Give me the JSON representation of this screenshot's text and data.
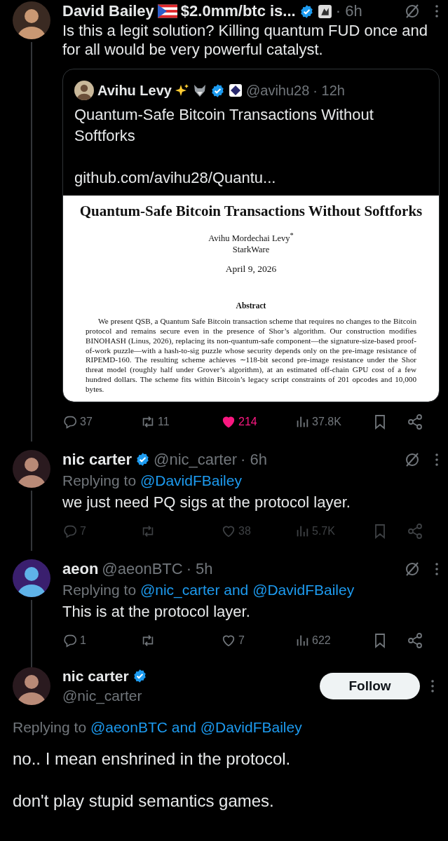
{
  "thread": [
    {
      "name": "David Bailey",
      "name_suffix": "$2.0mm/btc is...",
      "verified": true,
      "affiliate": true,
      "time": "· 6h",
      "text": "Is this a legit solution? Killing quantum FUD once and for all would be very powerful catalyst.",
      "quote": {
        "name": "Avihu Levy",
        "verified": true,
        "handle": "@avihu28",
        "time": "· 12h",
        "text": "Quantum-Safe Bitcoin Transactions Without Softforks",
        "link": "github.com/avihu28/Quantu...",
        "paper": {
          "title": "Quantum-Safe Bitcoin Transactions Without Softforks",
          "author": "Avihu Mordechai Levy$^{*}$",
          "affiliation": "StarkWare",
          "date": "April 9, 2026",
          "abstract_heading": "Abstract",
          "abstract": "We present QSB, a Quantum Safe Bitcoin transaction scheme that requires no changes to the Bitcoin protocol and remains secure even in the presence of Shor’s algorithm. Our construction modifies BINOHASH (Linus, 2026), replacing its non-quantum-safe component—the signature-size-based proof-of-work puzzle—with a hash-to-sig puzzle whose security depends only on the pre-image resistance of RIPEMD-160. The resulting scheme achieves ∼118-bit second pre-image resistance under the Shor threat model (roughly half under Grover’s algorithm), at an estimated off-chain GPU cost of a few hundred dollars. The scheme fits within Bitcoin’s legacy script constraints of 201 opcodes and 10,000 bytes."
        }
      },
      "actions": {
        "replies": "37",
        "reposts": "11",
        "likes": "214",
        "liked": true,
        "views": "37.8K",
        "dimmed": false
      }
    },
    {
      "name": "nic carter",
      "verified": true,
      "affiliate": false,
      "handle": "@nic_carter",
      "time": "· 6h",
      "replying_prefix": "Replying to",
      "replying_targets": "@DavidFBailey",
      "text": "we just need PQ sigs at the protocol layer.",
      "actions": {
        "replies": "7",
        "likes": "38",
        "liked": false,
        "views": "5.7K",
        "dimmed": true
      }
    },
    {
      "name": "aeon",
      "verified": false,
      "affiliate": false,
      "handle": "@aeonBTC",
      "time": "· 5h",
      "replying_prefix": "Replying to",
      "replying_targets": "@nic_carter and @DavidFBailey",
      "text": "This is at the protocol layer.",
      "actions": {
        "replies": "1",
        "likes": "7",
        "liked": false,
        "views": "622",
        "dimmed": false
      }
    }
  ],
  "focused": {
    "name": "nic carter",
    "verified": true,
    "handle": "@nic_carter",
    "follow": "Follow",
    "replying_prefix": "Replying to",
    "replying_targets": "@aeonBTC and @DavidFBailey",
    "paragraphs": [
      "no.. I mean enshrined in the protocol.",
      "don't play stupid semantics games."
    ]
  }
}
